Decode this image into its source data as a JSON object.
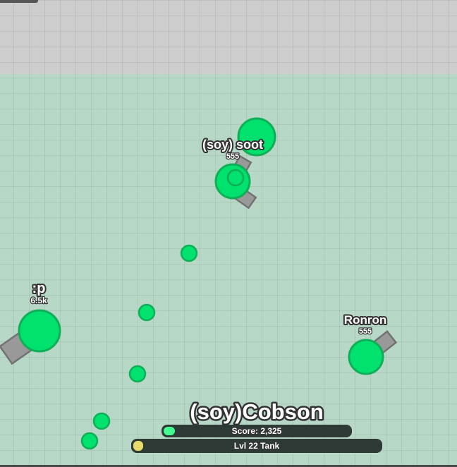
{
  "player": {
    "name": "(soy)Cobson",
    "score_text": "Score: 2,325",
    "score_progress": 0.06,
    "level_text": "Lvl 22 Tank",
    "level_progress": 0.04
  },
  "tanks": [
    {
      "id": "soot",
      "name": "(soy) soot",
      "score": "555"
    },
    {
      "id": "p",
      "name": ":p",
      "score": "6.5k"
    },
    {
      "id": "ronron",
      "name": "Ronron",
      "score": "555"
    }
  ],
  "colors": {
    "tank_body": "#00e16e",
    "tank_outline": "#0fae57",
    "barrel": "#999999",
    "barrel_outline": "#727272",
    "arena_background": "#b7d8c7",
    "outside_background": "#cdcdcd",
    "score_fill": "#43ff91",
    "level_fill": "#e8db6b",
    "bar_background": "#2e3a36"
  }
}
